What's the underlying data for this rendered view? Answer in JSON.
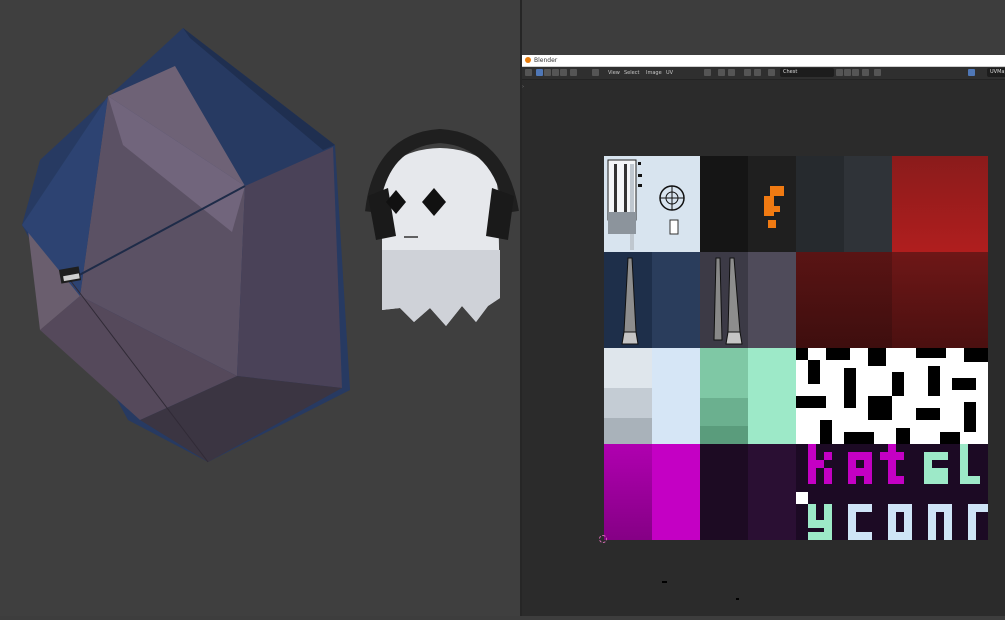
{
  "window": {
    "title": "Blender",
    "menu": [
      "View",
      "Select",
      "Image",
      "UV"
    ],
    "image_name": "Chest",
    "right_field": "UVMap"
  },
  "colors": {
    "umbrella_canopy": "#273a62",
    "umbrella_inner": "#5b5164",
    "ghost_body": "#e6e8ec",
    "headphones": "#1f1f1f",
    "accent_orange": "#f07a12",
    "magenta": "#c400c4",
    "mint": "#9de9c8",
    "dark_red": "#7a1616",
    "cyan_text": "#cfe4f7"
  },
  "viewport": {
    "objects": [
      "umbrella",
      "ghost-with-headphones"
    ]
  }
}
